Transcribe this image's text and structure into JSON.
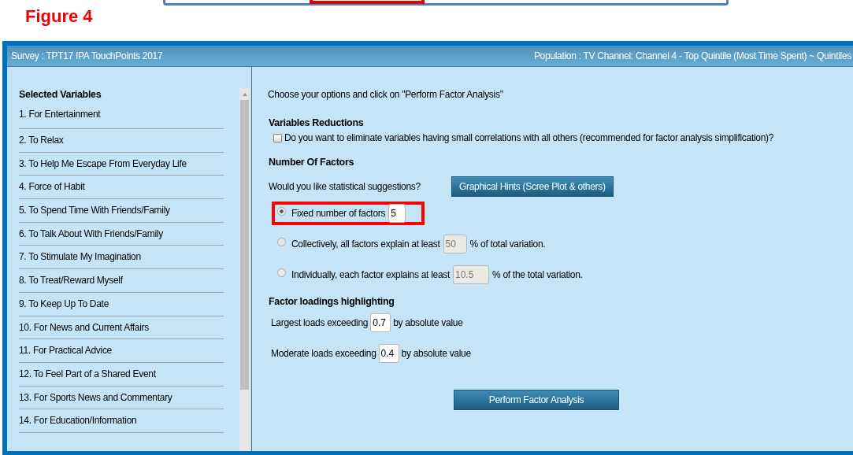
{
  "figure_title": "Figure 4",
  "header": {
    "survey": "Survey : TPT17 IPA TouchPoints 2017",
    "population": "Population : TV Channel: Channel 4 - Top Quintile (Most Time Spent) ~ Quintiles"
  },
  "sidebar": {
    "title": "Selected Variables",
    "items": [
      "1. For Entertainment",
      "2. To Relax",
      "3. To Help Me Escape From Everyday Life",
      "4. Force of Habit",
      "5. To Spend Time With Friends/Family",
      "6. To Talk About With Friends/Family",
      "7. To Stimulate My Imagination",
      "8. To Treat/Reward Myself",
      "9. To Keep Up To Date",
      "10. For News and Current Affairs",
      "11. For Practical Advice",
      "12. To Feel Part of a Shared Event",
      "13. For Sports News and Commentary",
      "14. For Education/Information"
    ]
  },
  "main": {
    "intro": "Choose your options and click on \"Perform Factor Analysis\"",
    "reductions": {
      "heading": "Variables Reductions",
      "checkbox_label": "Do you want to eliminate variables having small correlations with all others (recommended for factor analysis simplification)?",
      "checked": false
    },
    "factors": {
      "heading": "Number Of Factors",
      "suggestion_label": "Would you like statistical suggestions?",
      "hints_button": "Graphical Hints (Scree Plot & others)",
      "options": [
        {
          "before": "Fixed number of factors",
          "value": "5",
          "selected": true,
          "highlighted": true
        },
        {
          "before": "Collectively, all factors explain at least",
          "value": "50",
          "after": "% of total variation.",
          "selected": false,
          "highlighted": false
        },
        {
          "before": "Individually, each factor explains at least",
          "value": "10.5",
          "after": "% of the total variation.",
          "selected": false,
          "highlighted": false
        }
      ]
    },
    "loadings": {
      "heading": "Factor loadings highlighting",
      "rows": [
        {
          "before": "Largest loads exceeding",
          "value": "0.7",
          "after": "by absolute value"
        },
        {
          "before": "Moderate loads exceeding",
          "value": "0.4",
          "after": "by absolute value"
        }
      ]
    },
    "submit": "Perform Factor Analysis"
  }
}
